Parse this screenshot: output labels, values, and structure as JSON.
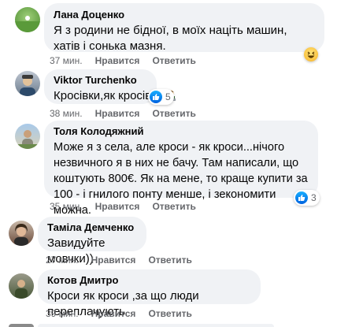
{
  "comments": [
    {
      "author": "Лана Доценко",
      "text": "Я з родини не бідної, в моїх націть машин, хатів і сонька мазня.",
      "time": "37 мин.",
      "like": "Нравится",
      "reply": "Ответить",
      "reaction": "haha-icon"
    },
    {
      "author": "Viktor Turchenko",
      "text": "Кросівки,як кросівки",
      "time": "38 мин.",
      "like": "Нравится",
      "reply": "Ответить",
      "reaction_count": "5",
      "emoji": "man-technologist-emoji"
    },
    {
      "author": "Толя Колодяжний",
      "text": "Може я з села, але кроси - як кроси...нічого незвичного я в них не бачу. Там написали, що коштують 800€. Як на мене, то краще купити за 100 - і гнилого понту менше, і зекономити можна.",
      "time": "35 мин.",
      "like": "Нравится",
      "reply": "Ответить",
      "reaction_count": "3"
    },
    {
      "author": "Таміла Демченко",
      "text": "Завидуйте мовчки))",
      "time": "27 мин.",
      "like": "Нравится",
      "reply": "Ответить"
    },
    {
      "author": "Котов Дмитро",
      "text": "Кроси як кроси ,за що люди переплачують",
      "time": "39 мин.",
      "like": "Нравится",
      "reply": "Ответить"
    }
  ],
  "colors": {
    "bubble": "#f0f2f5",
    "meta_text": "#65676b",
    "like_blue": "#0866ff"
  }
}
